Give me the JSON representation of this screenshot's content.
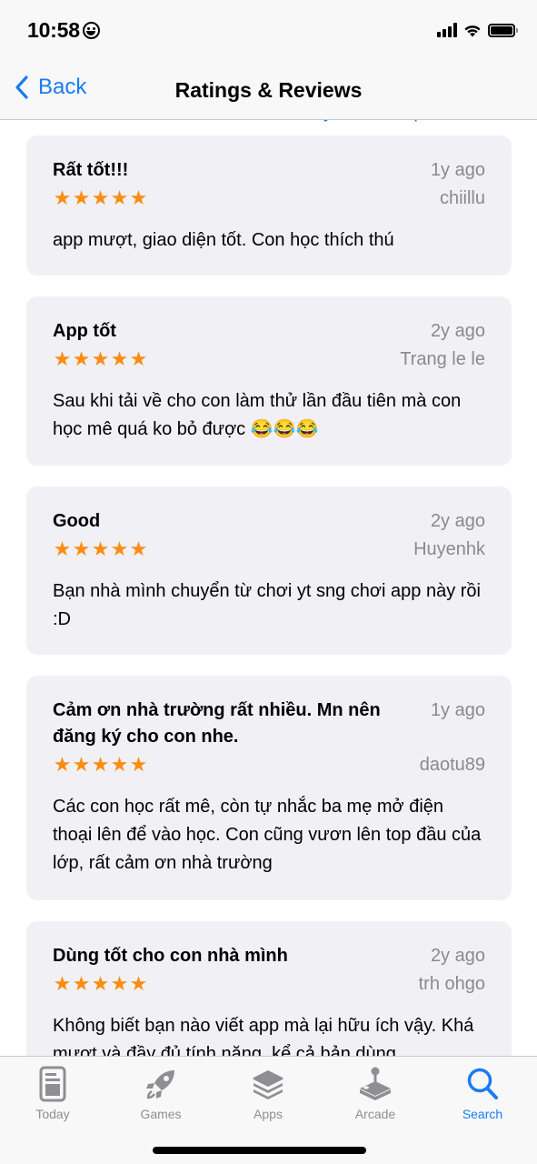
{
  "status_bar": {
    "time": "10:58"
  },
  "nav": {
    "back_label": "Back",
    "title": "Ratings & Reviews"
  },
  "sort": {
    "label": "Sort by Most Helpful"
  },
  "accent_color": "#1a7cf0",
  "star_color": "#fd8c14",
  "reviews": [
    {
      "title": "Rất tốt!!!",
      "date": "1y ago",
      "author": "chiillu",
      "rating": 5,
      "body": "app mượt, giao diện tốt. Con học thích thú"
    },
    {
      "title": "App tốt",
      "date": "2y ago",
      "author": "Trang le le",
      "rating": 5,
      "body": "Sau khi tải về cho con làm thử lần đầu tiên mà con học mê quá ko bỏ được 😂😂😂"
    },
    {
      "title": "Good",
      "date": "2y ago",
      "author": "Huyenhk",
      "rating": 5,
      "body": "Bạn nhà mình chuyển từ chơi yt sng chơi app này rồi :D"
    },
    {
      "title": "Cảm ơn nhà trường rất nhiều. Mn nên đăng ký cho con nhe.",
      "date": "1y ago",
      "author": "daotu89",
      "rating": 5,
      "body": "Các con học rất mê, còn tự nhắc ba mẹ mở điện thoại lên để vào học. Con cũng vươn lên top đầu của lớp, rất cảm ơn nhà trường"
    },
    {
      "title": "Dùng tốt cho con nhà mình",
      "date": "2y ago",
      "author": "trh ohgo",
      "rating": 5,
      "body": "Không biết bạn nào viết app mà lại hữu ích vậy. Khá mượt và đầy đủ tính năng, kể cả bản dùng"
    }
  ],
  "tabs": [
    {
      "label": "Today",
      "icon": "today-icon",
      "active": false
    },
    {
      "label": "Games",
      "icon": "rocket-icon",
      "active": false
    },
    {
      "label": "Apps",
      "icon": "layers-icon",
      "active": false
    },
    {
      "label": "Arcade",
      "icon": "joystick-icon",
      "active": false
    },
    {
      "label": "Search",
      "icon": "search-icon",
      "active": true
    }
  ]
}
